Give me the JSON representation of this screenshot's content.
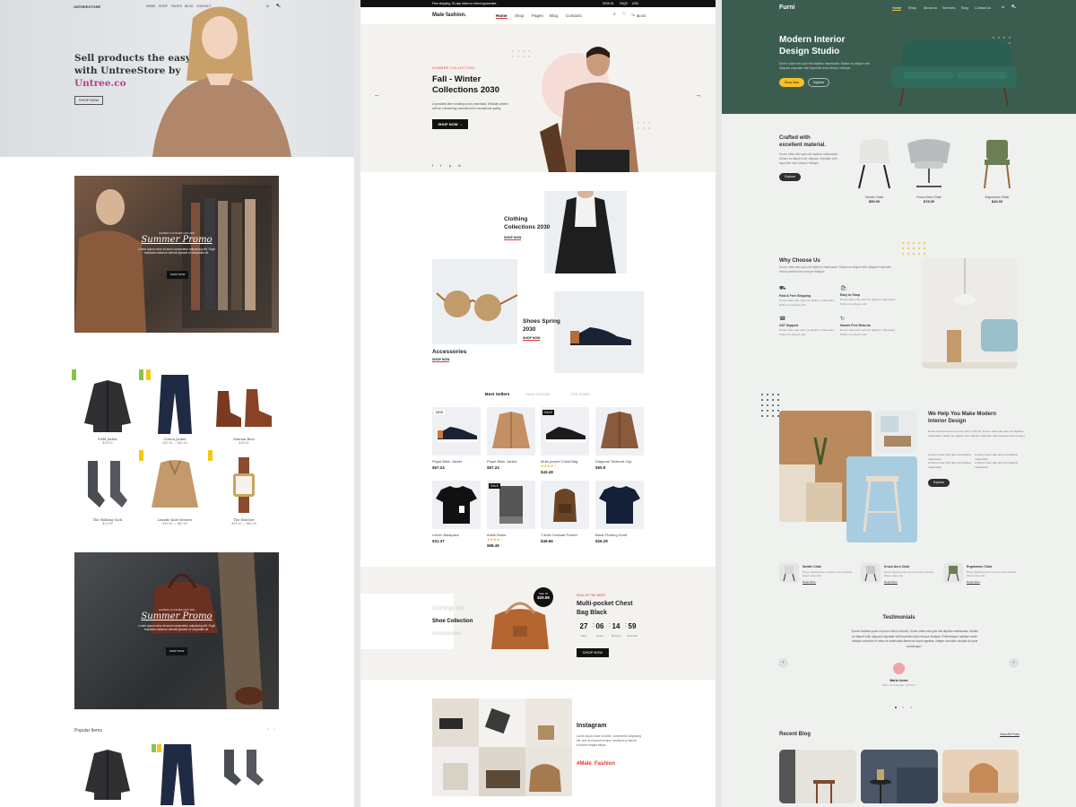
{
  "col1": {
    "brand": "UNTREESTORE",
    "nav": [
      "HOME",
      "SHOP",
      "PAGES",
      "BLOG",
      "CONTACT"
    ],
    "hero": {
      "line1": "Sell products the easy way",
      "line2": "with UntreeStore by",
      "accent": "Untree.co",
      "button": "SHOP NOW"
    },
    "promo1": {
      "kicker": "LIMITED CLOTHES OFF 30%",
      "title": "Summer Promo",
      "text1": "Lorem ipsum dolor sit amet consectetur adipisicing elit. Fugit",
      "text2": "explicabo laborum deleniti placeat ut voluptates sit.",
      "button": "SHOP NOW"
    },
    "products": [
      {
        "name": "Field Jacket",
        "price": "$39.00",
        "badge": "NEW"
      },
      {
        "name": "Cotton Jacket",
        "price": "$39.00 — $45.00",
        "badge": "NEW"
      },
      {
        "name": "Stanton Boot",
        "price": "$39.00",
        "badge": ""
      },
      {
        "name": "The Walking Sock",
        "price": "$29.00",
        "badge": ""
      },
      {
        "name": "Leaside Knit Sweater",
        "price": "$39.00 — $45.00",
        "badge": "NEW"
      },
      {
        "name": "The Watcher",
        "price": "$39.00 — $45.00",
        "badge": "NEW"
      }
    ],
    "promo2": {
      "kicker": "LIMITED CLOTHES OFF 30%",
      "title": "Summer Promo",
      "text1": "Lorem ipsum dolor sit amet consectetur adipisicing elit. Fugit",
      "text2": "explicabo laborum deleniti placeat ut voluptates sit.",
      "button": "SHOP NOW"
    },
    "popular_title": "Popular Items"
  },
  "col2": {
    "topbar": "Free shipping, 30-day return or refund guarantee.",
    "topbar_right": [
      "SIGN IN",
      "FAQS",
      "USD"
    ],
    "logo": "Male fashion.",
    "nav": [
      "Home",
      "Shop",
      "Pages",
      "Blog",
      "Contacts"
    ],
    "cart_total": "$0.00",
    "hero": {
      "kicker": "SUMMER COLLECTION",
      "title1": "Fall - Winter",
      "title2": "Collections 2030",
      "text1": "A specialist label creating luxury essentials. Ethically crafted",
      "text2": "with an unwavering commitment to exceptional quality.",
      "button": "SHOP NOW →"
    },
    "social": [
      "f",
      "t",
      "p",
      "in"
    ],
    "banners": [
      {
        "title1": "Clothing",
        "title2": "Collections 2030",
        "link": "SHOP NOW"
      },
      {
        "title1": "Accessories",
        "title2": "",
        "link": "SHOP NOW"
      },
      {
        "title1": "Shoes Spring",
        "title2": "2030",
        "link": "SHOP NOW"
      }
    ],
    "tabs": [
      "Best Sellers",
      "New Arrivals",
      "Hot Sales"
    ],
    "products": [
      {
        "name": "Piqué Biker Jacket",
        "price": "$67.24",
        "badge": "NEW"
      },
      {
        "name": "Piqué Biker Jacket",
        "price": "$67.24",
        "badge": ""
      },
      {
        "name": "Multi-pocket Chest Bag",
        "price": "$43.48",
        "badge": "SALE"
      },
      {
        "name": "Diagonal Textured Cap",
        "price": "$60.9",
        "badge": ""
      },
      {
        "name": "Lether Backpack",
        "price": "$31.37",
        "badge": ""
      },
      {
        "name": "Ankle Boots",
        "price": "$98.49",
        "badge": "SALE"
      },
      {
        "name": "T-shirt Contrast Pocket",
        "price": "$49.66",
        "badge": ""
      },
      {
        "name": "Basic Flowing Scarf",
        "price": "$26.28",
        "badge": ""
      }
    ],
    "deal": {
      "cats": [
        "Clothings Hot",
        "Shoe Collection",
        "Accessories"
      ],
      "price_label": "Sale Of",
      "price": "$29.99",
      "kicker": "DEAL OF THE WEEK",
      "title1": "Multi-pocket Chest",
      "title2": "Bag Black",
      "countdown": [
        {
          "v": "27",
          "l": "Days"
        },
        {
          "v": "06",
          "l": "Hours"
        },
        {
          "v": "14",
          "l": "Minutes"
        },
        {
          "v": "59",
          "l": "Seconds"
        }
      ],
      "button": "SHOP NOW"
    },
    "instagram": {
      "title": "Instagram",
      "text1": "Lorem ipsum dolor sit amet, consectetur adipiscing",
      "text2": "elit, sed do eiusmod tempor incididunt ut labore",
      "text3": "et dolore magna aliqua.",
      "tag": "#Male_Fashion"
    }
  },
  "col3": {
    "logo": "Furni",
    "nav": [
      "Home",
      "Shop",
      "About us",
      "Services",
      "Blog",
      "Contact us"
    ],
    "hero": {
      "title1": "Modern Interior",
      "title2": "Design Studio",
      "text1": "Donec vitae odio quis nisl dapibus malesuada. Nullam ac aliquet velit.",
      "text2": "Aliquam vulputate velit imperdiet dolor tempor tristique.",
      "btn1": "Shop Now",
      "btn2": "Explore"
    },
    "crafted": {
      "title1": "Crafted with",
      "title2": "excellent material.",
      "text1": "Donec vitae odio quis nisl dapibus malesuada.",
      "text2": "Nullam ac aliquet velit. Aliquam vulputate velit",
      "text3": "imperdiet dolor tempor tristique.",
      "button": "Explore"
    },
    "chairs": [
      {
        "name": "Nordic Chair",
        "price": "$50.00"
      },
      {
        "name": "Kruzo Aero Chair",
        "price": "$78.00"
      },
      {
        "name": "Ergonomic Chair",
        "price": "$43.00"
      }
    ],
    "why": {
      "title": "Why Choose Us",
      "text1": "Donec vitae odio quis nisl dapibus malesuada. Nullam ac aliquet velit. Aliquam vulputate",
      "text2": "velit imperdiet dolor tempor tristique.",
      "features": [
        "Fast & Free Shipping",
        "Easy to Shop",
        "24/7 Support",
        "Hassle Free Returns"
      ],
      "ftext": "Donec vitae odio quis nisl dapibus malesuada. Nullam ac aliquet velit."
    },
    "help": {
      "title1": "We Help You Make Modern",
      "title2": "Interior Design",
      "text1": "Donec facilisis quam ut purus rutrum lobortis. Donec vitae odio quis nisl dapibus",
      "text2": "malesuada. Nullam ac aliquet velit. Aliquam vulputate velit imperdiet dolor tempor",
      "bullets": [
        "Donec vitae odio quis nisl dapibus malesuada",
        "Donec vitae odio quis nisl dapibus malesuada",
        "Donec vitae odio quis nisl dapibus malesuada",
        "Donec vitae odio quis nisl dapibus malesuada"
      ],
      "button": "Explore"
    },
    "mini": [
      {
        "name": "Nordic Chair",
        "link": "Read More"
      },
      {
        "name": "Kruzo Aero Chair",
        "link": "Read More"
      },
      {
        "name": "Ergonomic Chair",
        "link": "Read More"
      }
    ],
    "mini_text": "Donec facilisis quam ut purus rutrum lobortis. Donec vitae odio",
    "testimonials": {
      "title": "Testimonials",
      "quote1": "“Donec facilisis quam ut purus rutrum lobortis. Donec vitae odio quis nisl dapibus malesuada. Nullam",
      "quote2": "ac aliquet velit. Aliquam vulputate velit imperdiet dolor tempor tristique. Pellentesque habitant morbi",
      "quote3": "tristique senectus et netus et malesuada fames ac turpis egestas. Integer convallis volutpat dui quis",
      "quote4": "scelerisque.”",
      "name": "Maria Jones",
      "role": "CEO, Co-Founder, XYZ Inc."
    },
    "blog": {
      "title": "Recent Blog",
      "link": "View All Posts"
    }
  }
}
